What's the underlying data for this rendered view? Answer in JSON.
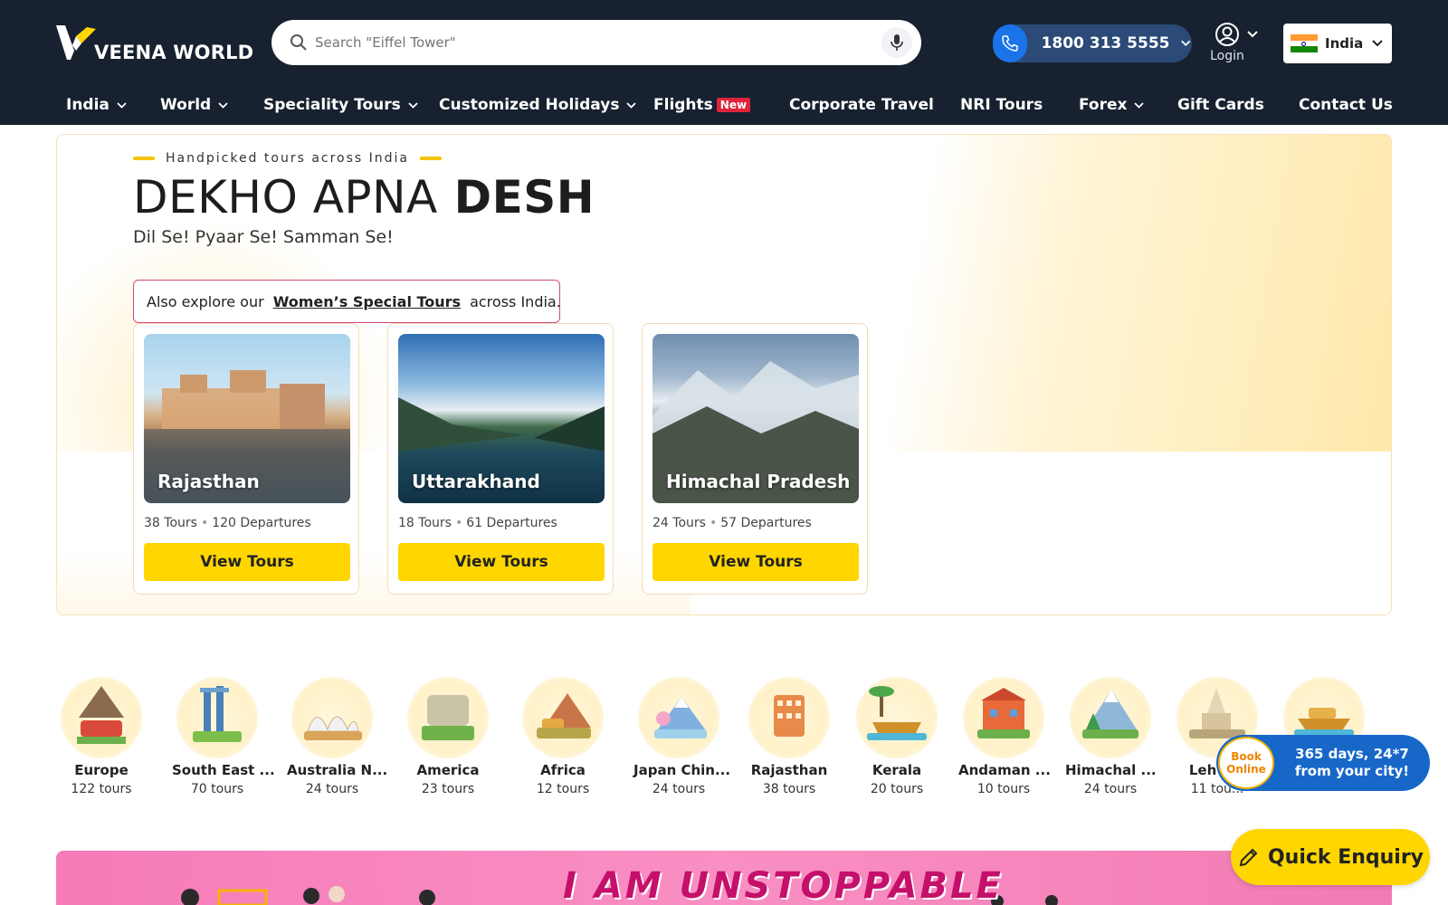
{
  "header": {
    "brand": "VEENA WORLD",
    "search_placeholder": "Search \"Eiffel Tower\"",
    "phone": "1800 313 5555",
    "login_label": "Login",
    "country": "India"
  },
  "nav": {
    "items": [
      {
        "label": "India"
      },
      {
        "label": "World"
      },
      {
        "label": "Speciality Tours"
      },
      {
        "label": "Customized Holidays"
      },
      {
        "label": "Flights"
      },
      {
        "label": "Corporate Travel"
      },
      {
        "label": "NRI Tours"
      },
      {
        "label": "Forex"
      },
      {
        "label": "Gift Cards"
      },
      {
        "label": "Contact Us"
      }
    ],
    "new_badge": "New"
  },
  "hero": {
    "eyebrow": "Handpicked tours across India",
    "title_light": "DEKHO APNA",
    "title_bold": "DESH",
    "subtitle": "Dil Se! Pyaar Se! Samman Se!",
    "explore_prefix": "Also explore our",
    "explore_link": "Women’s Special Tours",
    "explore_suffix": "across India.",
    "cards": [
      {
        "name": "Rajasthan",
        "tours": "38 Tours",
        "departures": "120 Departures",
        "button": "View Tours"
      },
      {
        "name": "Uttarakhand",
        "tours": "18 Tours",
        "departures": "61 Departures",
        "button": "View Tours"
      },
      {
        "name": "Himachal Pradesh",
        "tours": "24 Tours",
        "departures": "57 Departures",
        "button": "View Tours"
      }
    ]
  },
  "destinations": [
    {
      "name": "Europe",
      "count": "122 tours"
    },
    {
      "name": "South East ...",
      "count": "70 tours"
    },
    {
      "name": "Australia N...",
      "count": "24 tours"
    },
    {
      "name": "America",
      "count": "23 tours"
    },
    {
      "name": "Africa",
      "count": "12 tours"
    },
    {
      "name": "Japan Chin...",
      "count": "24 tours"
    },
    {
      "name": "Rajasthan",
      "count": "38 tours"
    },
    {
      "name": "Kerala",
      "count": "20 tours"
    },
    {
      "name": "Andaman ...",
      "count": "10 tours"
    },
    {
      "name": "Himachal ...",
      "count": "24 tours"
    },
    {
      "name": "Leh L...",
      "count": "11 tou..."
    }
  ],
  "book_online": {
    "badge_line1": "Book",
    "badge_line2": "Online",
    "text_line1": "365 days, 24*7",
    "text_line2": "from your city!"
  },
  "quick_enquiry": "Quick Enquiry",
  "banner": {
    "text": "I AM UNSTOPPABLE"
  },
  "colors": {
    "header_bg": "#17212f",
    "accent_yellow": "#ffd600",
    "phone_blue": "#1a73e8"
  }
}
